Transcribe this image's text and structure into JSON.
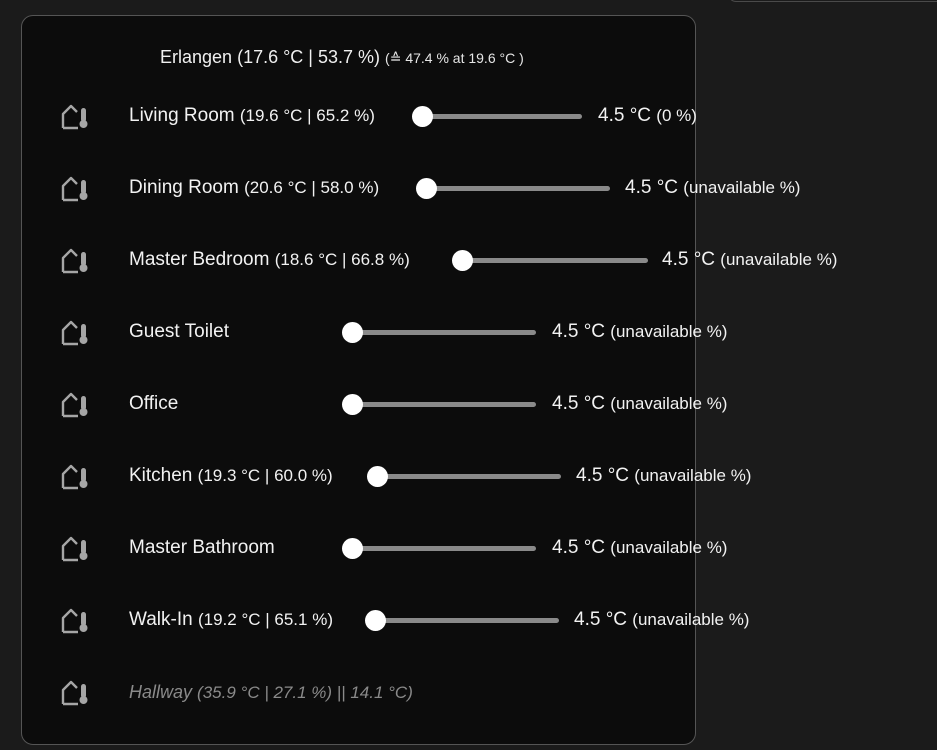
{
  "header": {
    "location": "Erlangen",
    "main_reading": "(17.6 °C | 53.7 %)",
    "sub_reading": "(≙ 47.4 % at 19.6 °C )"
  },
  "rooms": [
    {
      "name": "Living Room",
      "reading": "(19.6 °C | 65.2 %)",
      "setpoint": "4.5 °C",
      "status": "(0 %)",
      "slider_value": 0
    },
    {
      "name": "Dining Room",
      "reading": "(20.6 °C | 58.0 %)",
      "setpoint": "4.5 °C",
      "status": "(unavailable %)",
      "slider_value": 0
    },
    {
      "name": "Master Bedroom",
      "reading": "(18.6 °C | 66.8 %)",
      "setpoint": "4.5 °C",
      "status": "(unavailable %)",
      "slider_value": 0
    },
    {
      "name": "Guest Toilet",
      "reading": "",
      "setpoint": "4.5 °C",
      "status": "(unavailable %)",
      "slider_value": 0
    },
    {
      "name": "Office",
      "reading": "",
      "setpoint": "4.5 °C",
      "status": "(unavailable %)",
      "slider_value": 0
    },
    {
      "name": "Kitchen",
      "reading": "(19.3 °C | 60.0 %)",
      "setpoint": "4.5 °C",
      "status": "(unavailable %)",
      "slider_value": 0
    },
    {
      "name": "Master Bathroom",
      "reading": "",
      "setpoint": "4.5 °C",
      "status": "(unavailable %)",
      "slider_value": 0
    },
    {
      "name": "Walk-In",
      "reading": "(19.2 °C | 65.1 %)",
      "setpoint": "4.5 °C",
      "status": "(unavailable %)",
      "slider_value": 0
    }
  ],
  "hallway": {
    "name": "Hallway",
    "reading": "(35.9 °C | 27.1 %) || 14.1 °C)"
  },
  "icons": {
    "room": "home-thermometer-icon"
  },
  "colors": {
    "background": "#1b1b1b",
    "card": "#0c0c0c",
    "track": "#8a8a8a",
    "thumb": "#ffffff",
    "disabled_text": "#8a8a8a"
  }
}
